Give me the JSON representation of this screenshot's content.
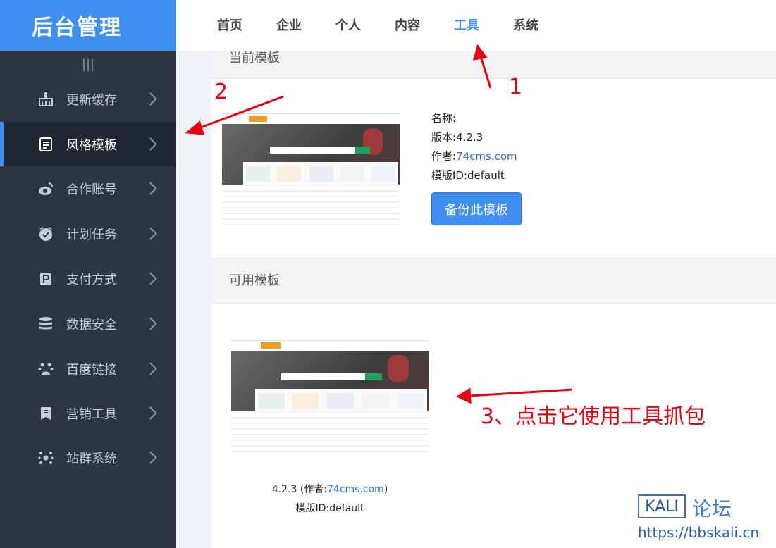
{
  "brand": {
    "title": "后台管理"
  },
  "topnav": {
    "items": [
      "首页",
      "企业",
      "个人",
      "内容",
      "工具",
      "系统"
    ],
    "active_index": 4
  },
  "sidebar": {
    "collapse_glyph": "|||",
    "items": [
      {
        "label": "更新缓存",
        "icon": "broom-icon"
      },
      {
        "label": "风格模板",
        "icon": "template-icon"
      },
      {
        "label": "合作账号",
        "icon": "weibo-icon"
      },
      {
        "label": "计划任务",
        "icon": "clock-icon"
      },
      {
        "label": "支付方式",
        "icon": "payment-icon"
      },
      {
        "label": "数据安全",
        "icon": "database-icon"
      },
      {
        "label": "百度链接",
        "icon": "baidu-paw-icon"
      },
      {
        "label": "营销工具",
        "icon": "bookmark-icon"
      },
      {
        "label": "站群系统",
        "icon": "network-icon"
      }
    ],
    "active_index": 1
  },
  "current_template": {
    "section_title": "当前模板",
    "name_label": "名称:",
    "version_label": "版本:",
    "version_value": "4.2.3",
    "author_label": "作者:",
    "author_value": "74cms.com",
    "id_label": "模版ID:",
    "id_value": "default",
    "backup_button": "备份此模板"
  },
  "available_templates": {
    "section_title": "可用模板",
    "items": [
      {
        "version": "4.2.3",
        "author_prefix": "(作者:",
        "author": "74cms.com",
        "author_suffix": ")",
        "id_label": "模版ID:",
        "id_value": "default"
      }
    ]
  },
  "annotations": {
    "label_1": "1",
    "label_2": "2",
    "label_3": "3、点击它使用工具抓包"
  },
  "watermark": {
    "logo": "KALI",
    "forum": "论坛",
    "url": "https://bbskali.cn"
  },
  "colors": {
    "accent": "#3f8ff0",
    "sidebar_bg": "#2e3542",
    "annotation_red": "#e60012"
  }
}
